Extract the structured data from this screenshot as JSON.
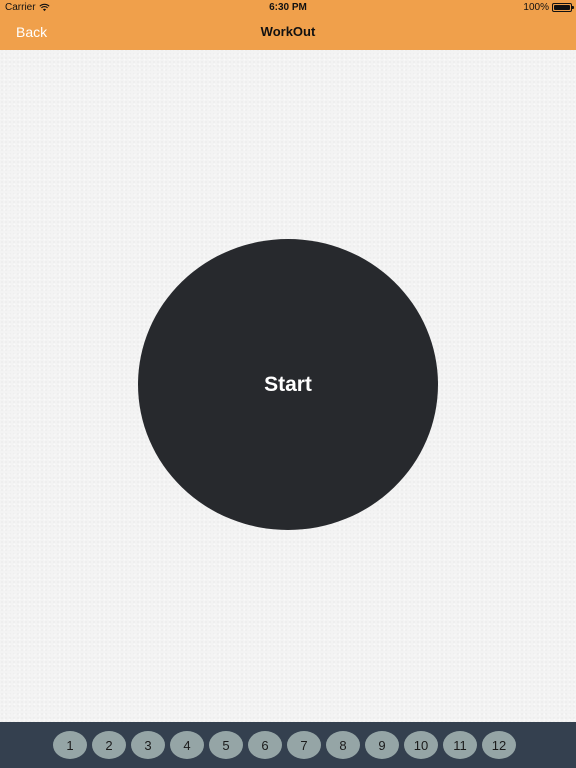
{
  "status_bar": {
    "carrier": "Carrier",
    "wifi_icon": "wifi-icon",
    "time": "6:30 PM",
    "battery_text": "100%",
    "battery_level": 1.0
  },
  "nav_bar": {
    "back_label": "Back",
    "title": "WorkOut"
  },
  "main": {
    "start_label": "Start"
  },
  "bottom_bar": {
    "items": [
      "1",
      "2",
      "3",
      "4",
      "5",
      "6",
      "7",
      "8",
      "9",
      "10",
      "11",
      "12"
    ]
  },
  "colors": {
    "nav_bar": "#f0a04b",
    "start_button": "#27292d",
    "bottom_bar": "#34404f",
    "number_button": "#95a5a6"
  }
}
